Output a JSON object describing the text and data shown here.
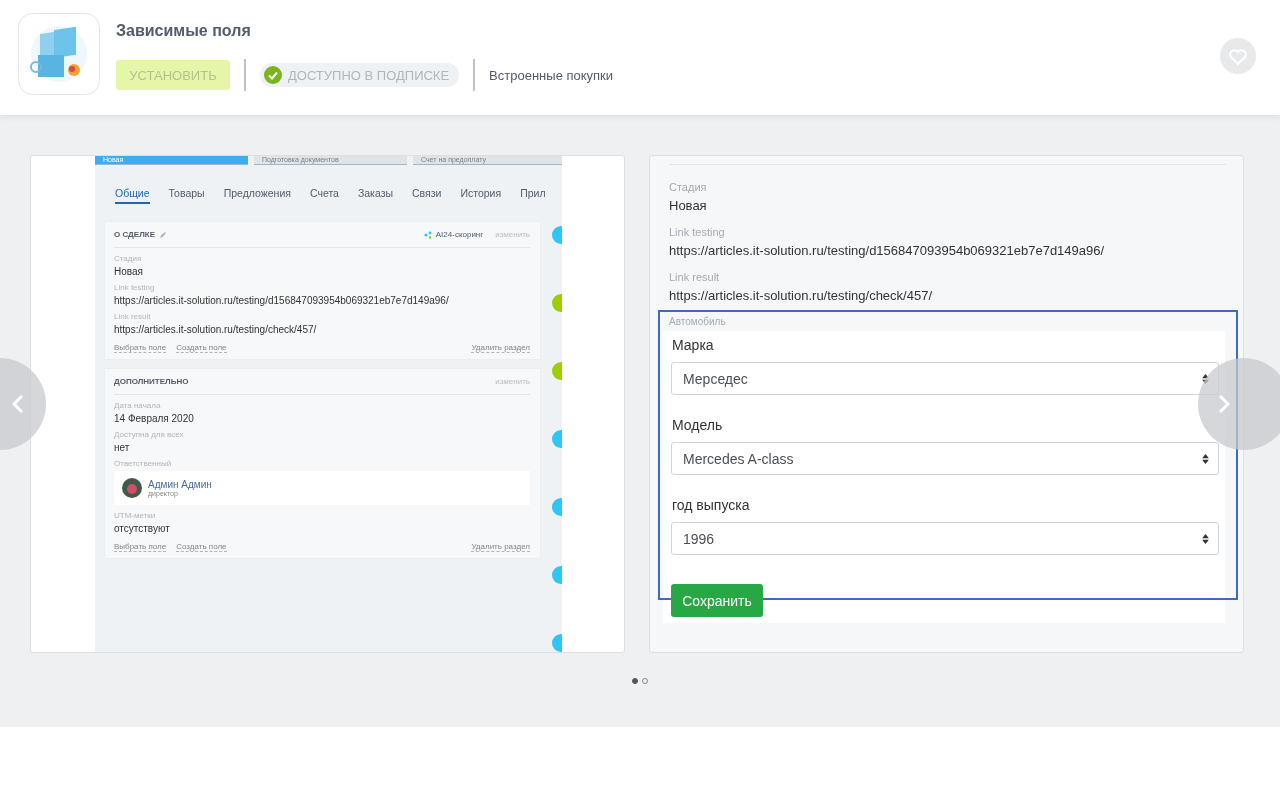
{
  "app": {
    "title": "Зависимые поля",
    "install_button": {
      "label": "УСТАНОВИТЬ",
      "disabled": true
    },
    "subscription_badge": "ДОСТУПНО В ПОДПИСКЕ",
    "purchases": "Встроенные покупки"
  },
  "gallery": {
    "slides": [
      {
        "kind": "deal",
        "stages": [
          {
            "label": "Новая",
            "selected": true
          },
          {
            "label": "Подготовка документов",
            "selected": false
          },
          {
            "label": "Счет на предоплату",
            "selected": false
          }
        ],
        "tabs": [
          {
            "label": "Общие",
            "selected": true
          },
          {
            "label": "Товары",
            "selected": false
          },
          {
            "label": "Предложения",
            "selected": false
          },
          {
            "label": "Счета",
            "selected": false
          },
          {
            "label": "Заказы",
            "selected": false
          },
          {
            "label": "Связи",
            "selected": false
          },
          {
            "label": "История",
            "selected": false
          },
          {
            "label": "Прил",
            "selected": false
          }
        ],
        "sections": [
          {
            "title": "О СДЕЛКЕ",
            "renamable": true,
            "scoring": "AI24-скоринг",
            "edit": "изменить",
            "fields": [
              {
                "kind": "text",
                "label": "Стадия",
                "value": "Новая"
              },
              {
                "kind": "text",
                "label": "Link testing",
                "value": "https://articles.it-solution.ru/testing/d156847093954b069321eb7e7d149a96/"
              },
              {
                "kind": "text",
                "label": "Link result",
                "value": "https://articles.it-solution.ru/testing/check/457/"
              }
            ],
            "links": [
              "Выбрать поле",
              "Создать поле"
            ],
            "delete": "Удалить раздел"
          },
          {
            "title": "ДОПОЛНИТЕЛЬНО",
            "renamable": false,
            "edit": "изменить",
            "fields": [
              {
                "kind": "text",
                "label": "Дата начала",
                "value": "14 Февраля 2020"
              },
              {
                "kind": "text",
                "label": "Доступна для всех",
                "value": "нет"
              },
              {
                "kind": "person",
                "label": "Ответственный",
                "value": "Админ Админ",
                "role": "директор"
              },
              {
                "kind": "text",
                "label": "UTM-метки",
                "value": "отсутствуют"
              }
            ],
            "links": [
              "Выбрать поле",
              "Создать поле"
            ],
            "delete": "Удалить раздел"
          }
        ],
        "timeline": [
          {
            "color": "#2fc6f6"
          },
          {
            "color": "#9dcf00"
          },
          {
            "color": "#9dcf00"
          },
          {
            "color": "#2fc6f6"
          },
          {
            "color": "#2fc6f6"
          },
          {
            "color": "#2fc6f6"
          },
          {
            "color": "#2fc6f6"
          }
        ]
      },
      {
        "kind": "form",
        "fields": [
          {
            "label": "Стадия",
            "value": "Новая"
          },
          {
            "label": "Link testing",
            "value": "https://articles.it-solution.ru/testing/d156847093954b069321eb7e7d149a96/"
          },
          {
            "label": "Link result",
            "value": "https://articles.it-solution.ru/testing/check/457/"
          }
        ],
        "group": {
          "title": "Автомобиль",
          "highlighted": true,
          "selects": [
            {
              "label": "Марка",
              "value": "Мерседес"
            },
            {
              "label": "Модель",
              "value": "Mercedes A-class"
            },
            {
              "label": "год выпуска",
              "value": "1996"
            }
          ],
          "button": "Сохранить"
        }
      }
    ],
    "dots": [
      {
        "selected": true
      },
      {
        "selected": false
      }
    ]
  }
}
